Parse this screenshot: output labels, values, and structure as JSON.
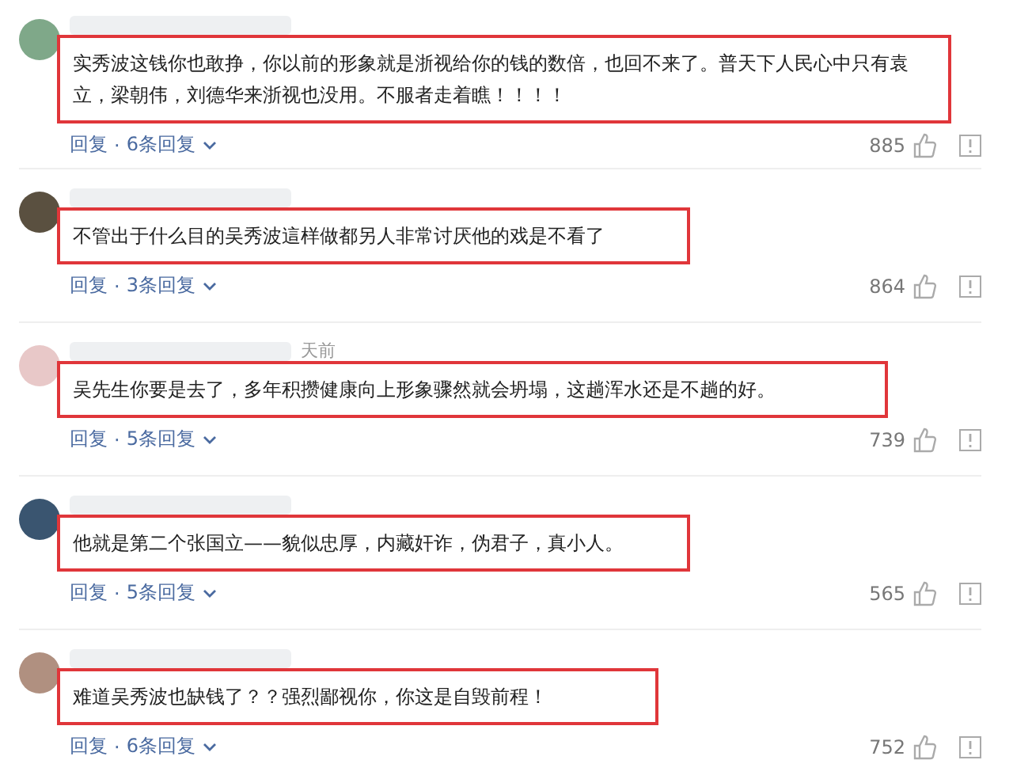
{
  "comments": [
    {
      "text": "实秀波这钱你也敢挣，你以前的形象就是浙视给你的钱的数倍，也回不来了。普天下人民心中只有袁立，梁朝伟，刘德华来浙视也没用。不服者走着瞧！！！！",
      "reply": "回复",
      "separator": "·",
      "replies": "6条回复",
      "likes": "885"
    },
    {
      "text": "不管出于什么目的吴秀波這样做都另人非常讨厌他的戏是不看了",
      "reply": "回复",
      "separator": "·",
      "replies": "3条回复",
      "likes": "864"
    },
    {
      "time": "天前",
      "text": "吴先生你要是去了，多年积攒健康向上形象骤然就会坍塌，这趟浑水还是不趟的好。",
      "reply": "回复",
      "separator": "·",
      "replies": "5条回复",
      "likes": "739"
    },
    {
      "text": "他就是第二个张国立——貌似忠厚，内藏奸诈，伪君子，真小人。",
      "reply": "回复",
      "separator": "·",
      "replies": "5条回复",
      "likes": "565"
    },
    {
      "text": "难道吴秀波也缺钱了？？强烈鄙视你，你这是自毁前程！",
      "reply": "回复",
      "separator": "·",
      "replies": "6条回复",
      "likes": "752"
    }
  ]
}
